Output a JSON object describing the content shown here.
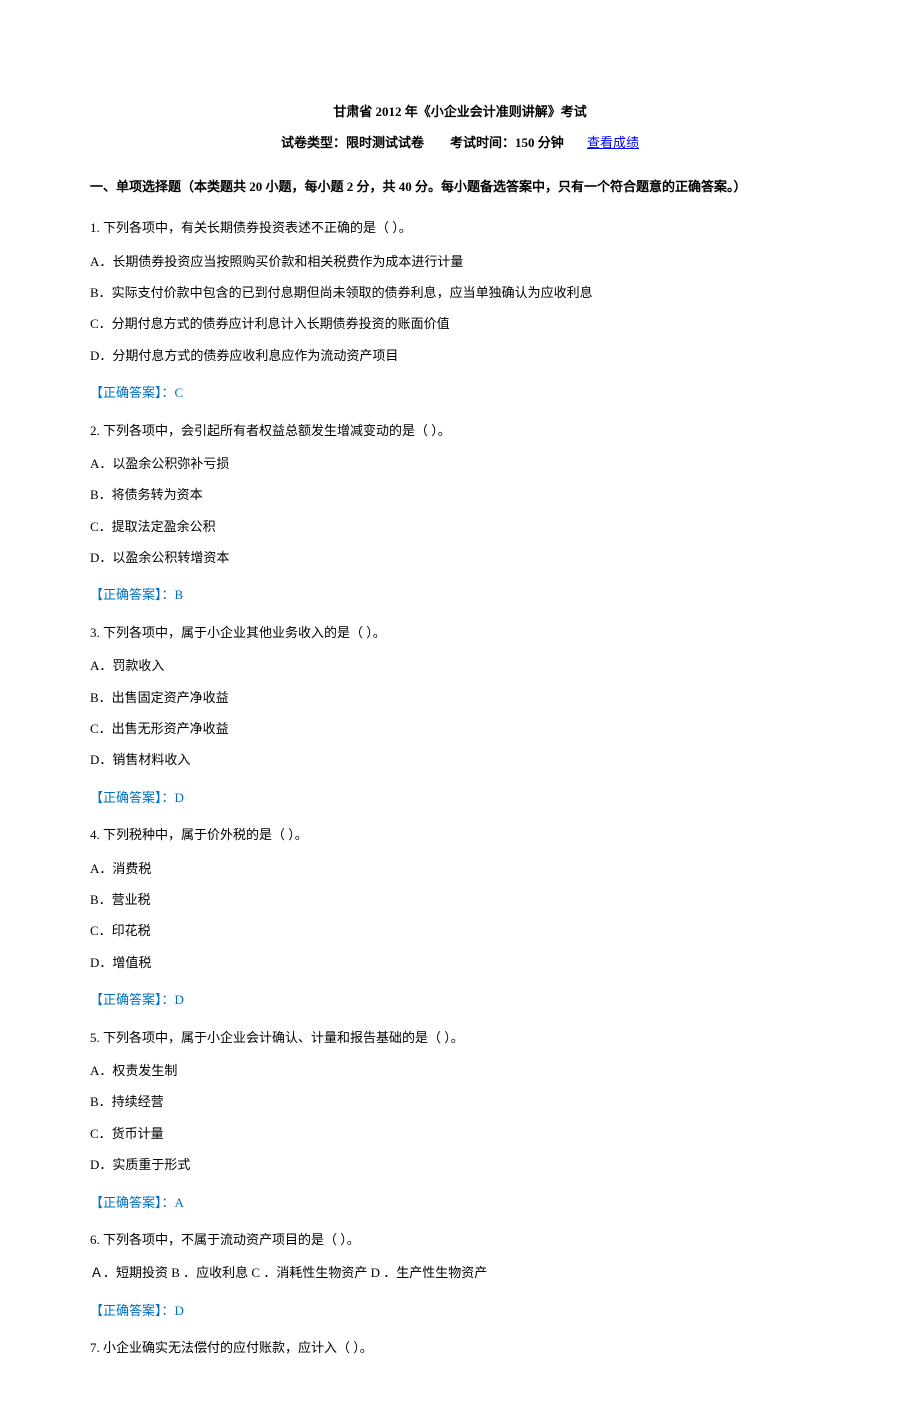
{
  "title": "甘肃省 2012 年《小企业会计准则讲解》考试",
  "subtitle_prefix": "试卷类型：限时测试试卷  考试时间：150 分钟",
  "view_score_link": "查看成绩",
  "section1_heading": "一、单项选择题（本类题共 20 小题，每小题 2 分，共 40 分。每小题备选答案中，只有一个符合题意的正确答案。）",
  "q1": {
    "stem": "1. 下列各项中，有关长期债券投资表述不正确的是（ ）。",
    "A": "A．长期债券投资应当按照购买价款和相关税费作为成本进行计量",
    "B": "B．实际支付价款中包含的已到付息期但尚未领取的债券利息，应当单独确认为应收利息",
    "C": "C．分期付息方式的债券应计利息计入长期债券投资的账面价值",
    "D": "D．分期付息方式的债券应收利息应作为流动资产项目",
    "answer": "【正确答案】：C"
  },
  "q2": {
    "stem": "2. 下列各项中，会引起所有者权益总额发生增减变动的是（ ）。",
    "A": "A．以盈余公积弥补亏损",
    "B": "B．将债务转为资本",
    "C": "C．提取法定盈余公积",
    "D": "D．以盈余公积转增资本",
    "answer": "【正确答案】：B"
  },
  "q3": {
    "stem": "3. 下列各项中，属于小企业其他业务收入的是（ ）。",
    "A": "A．罚款收入",
    "B": "B．出售固定资产净收益",
    "C": "C．出售无形资产净收益",
    "D": "D．销售材料收入",
    "answer": "【正确答案】：D"
  },
  "q4": {
    "stem": "4. 下列税种中，属于价外税的是（ ）。",
    "A": "A．消费税",
    "B": "B．营业税",
    "C": "C．印花税",
    "D": "D．增值税",
    "answer": "【正确答案】：D"
  },
  "q5": {
    "stem": "5. 下列各项中，属于小企业会计确认、计量和报告基础的是（ ）。",
    "A": "A．权责发生制",
    "B": "B．持续经营",
    "C": "C．货币计量",
    "D": "D．实质重于形式",
    "answer": "【正确答案】：A"
  },
  "q6": {
    "stem": "6. 下列各项中，不属于流动资产项目的是（ ）。",
    "inline": "Ａ．短期投资 B ．应收利息 C ．消耗性生物资产 D ．生产性生物资产",
    "answer": "【正确答案】：D"
  },
  "q7": {
    "stem": "7. 小企业确实无法偿付的应付账款，应计入（ ）。"
  }
}
